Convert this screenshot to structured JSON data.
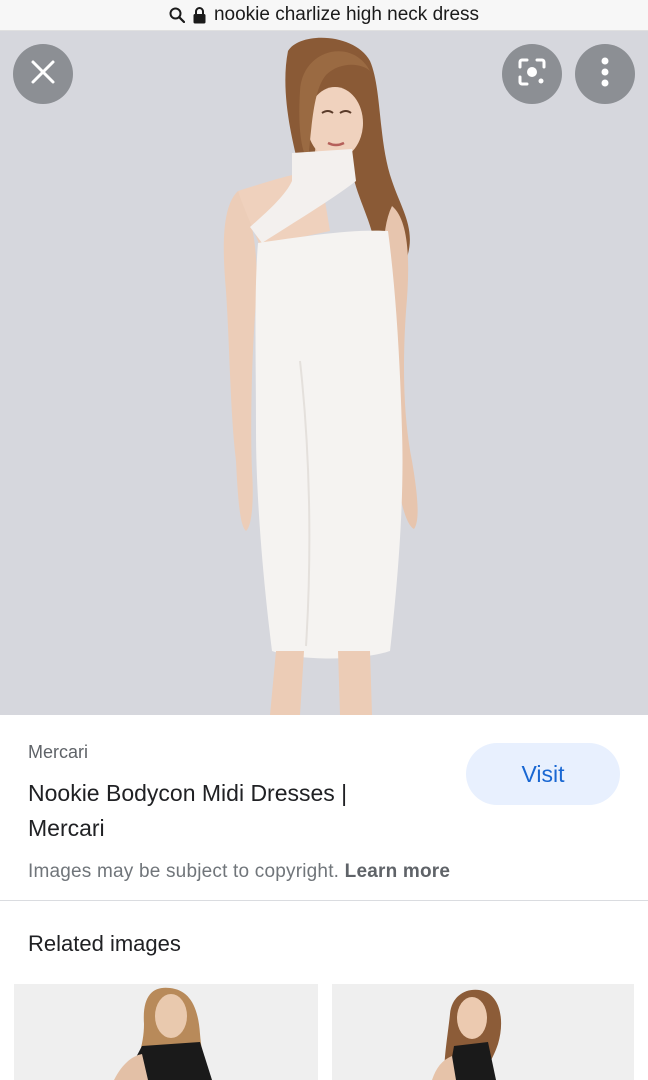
{
  "browser": {
    "url_text": "nookie charlize high neck dress",
    "search_icon": "search-icon",
    "lock_icon": "lock-icon"
  },
  "viewer": {
    "close_icon": "close-icon",
    "lens_icon": "lens-icon",
    "more_icon": "more-vert-icon",
    "background_color": "#d6d7dd"
  },
  "result": {
    "source": "Mercari",
    "title": "Nookie Bodycon Midi Dresses | Mercari",
    "visit_label": "Visit",
    "copyright_text": "Images may be subject to copyright.",
    "learn_more_label": "Learn more",
    "accent_color": "#1967d2"
  },
  "related": {
    "heading": "Related images"
  }
}
